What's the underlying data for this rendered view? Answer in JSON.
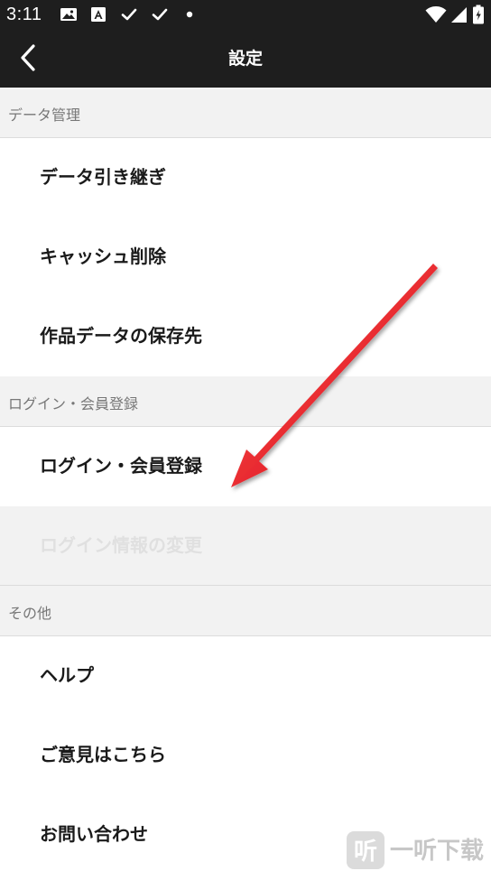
{
  "status_bar": {
    "time": "3:11",
    "icons_left": [
      "image-icon",
      "a-notification-icon",
      "check-icon",
      "check-icon",
      "dot-icon"
    ],
    "icons_right": [
      "wifi-icon",
      "signal-icon",
      "battery-icon"
    ]
  },
  "app_bar": {
    "title": "設定",
    "back_icon": "chevron-left-icon",
    "background": "#1e1e1e"
  },
  "sections": [
    {
      "header": "データ管理",
      "items": [
        {
          "label": "データ引き継ぎ",
          "enabled": true
        },
        {
          "label": "キャッシュ削除",
          "enabled": true
        },
        {
          "label": "作品データの保存先",
          "enabled": true
        }
      ]
    },
    {
      "header": "ログイン・会員登録",
      "items": [
        {
          "label": "ログイン・会員登録",
          "enabled": true
        },
        {
          "label": "ログイン情報の変更",
          "enabled": false
        }
      ]
    },
    {
      "header": "その他",
      "items": [
        {
          "label": "ヘルプ",
          "enabled": true
        },
        {
          "label": "ご意見はこちら",
          "enabled": true
        },
        {
          "label": "お問い合わせ",
          "enabled": true
        }
      ]
    }
  ],
  "annotation": {
    "arrow_color": "#e8141b"
  },
  "watermark": {
    "text": "一听下载"
  }
}
